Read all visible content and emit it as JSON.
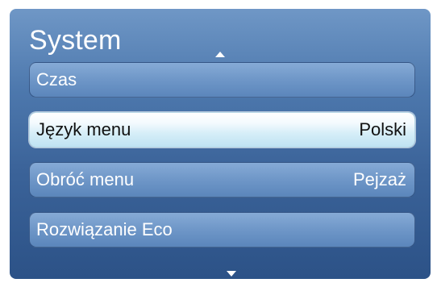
{
  "menu": {
    "title": "System",
    "items": [
      {
        "label": "Czas",
        "value": ""
      },
      {
        "label": "Język menu",
        "value": "Polski",
        "selected": true
      },
      {
        "label": "Obróć menu",
        "value": "Pejzaż"
      },
      {
        "label": "Rozwiązanie Eco",
        "value": ""
      }
    ]
  },
  "icons": {
    "scroll_up": "triangle-up-icon",
    "scroll_down": "triangle-down-icon"
  },
  "colors": {
    "panel_top": "#6f97c6",
    "panel_bottom": "#2c5287",
    "item_bg": "#6f97c8",
    "selected_bg": "#d6eef8",
    "text_light": "#ffffff",
    "text_dark": "#111111"
  }
}
